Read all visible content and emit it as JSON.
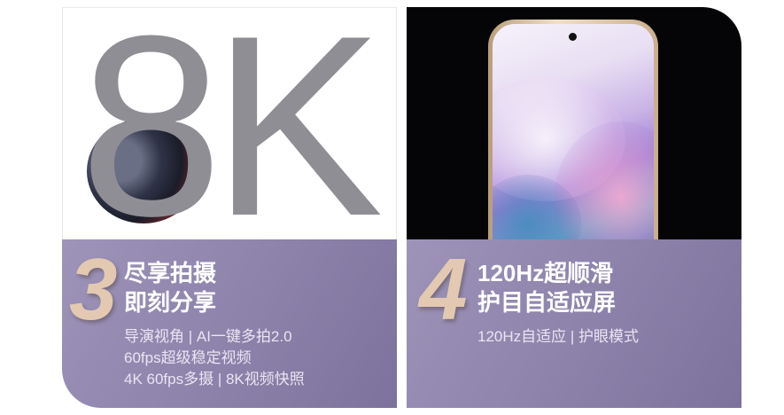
{
  "left_card": {
    "hero_text": "8K",
    "number": "3",
    "headline": [
      "尽享拍摄",
      "即刻分享"
    ],
    "features": [
      "导演视角 | AI一键多拍2.0",
      "60fps超级稳定视频",
      "4K 60fps多摄 | 8K视频快照"
    ]
  },
  "right_card": {
    "number": "4",
    "headline": [
      "120Hz超顺滑",
      "护目自适应屏"
    ],
    "features": [
      "120Hz自适应 | 护眼模式"
    ]
  },
  "colors": {
    "panel": "#8f85ad",
    "number": "#e3c9b1",
    "hero_text": "#8f8e95",
    "right_background": "#050407"
  }
}
